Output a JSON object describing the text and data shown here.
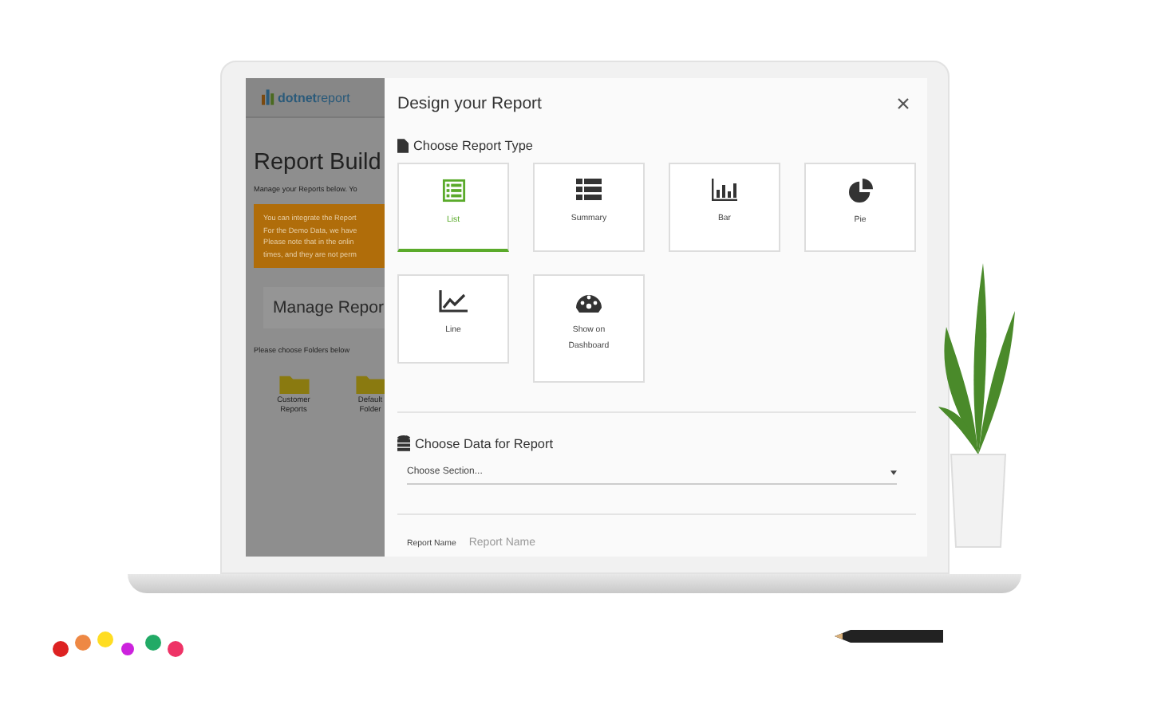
{
  "background_app": {
    "logo": "**dotnet**report",
    "title": "Report Build",
    "subtitle": "Manage your Reports below. Yo",
    "notice_lines": [
      "You can integrate the Report",
      "For the Demo Data, we have",
      "Please note that in the onlin",
      "times, and they are not perm"
    ],
    "panel_title": "Manage Repor",
    "folder_prompt": "Please choose Folders below",
    "folders": [
      {
        "label": "Customer Reports"
      },
      {
        "label": "Default Folder"
      }
    ]
  },
  "dialog": {
    "title": "Design your Report",
    "report_type": {
      "heading": "Choose Report Type",
      "types": [
        {
          "kind": "list",
          "label": "List",
          "selected": true
        },
        {
          "kind": "summary",
          "label": "Summary",
          "selected": false
        },
        {
          "kind": "bar",
          "label": "Bar",
          "selected": false
        },
        {
          "kind": "pie",
          "label": "Pie",
          "selected": false
        },
        {
          "kind": "line",
          "label": "Line",
          "selected": false
        },
        {
          "kind": "dashboard",
          "label": "Show on Dashboard",
          "selected": false
        }
      ]
    },
    "data_section": {
      "heading": "Choose Data for Report",
      "select": {
        "placeholder": "Choose Section..."
      }
    },
    "report_name": {
      "label": "Report Name",
      "placeholder": "Report Name"
    }
  }
}
